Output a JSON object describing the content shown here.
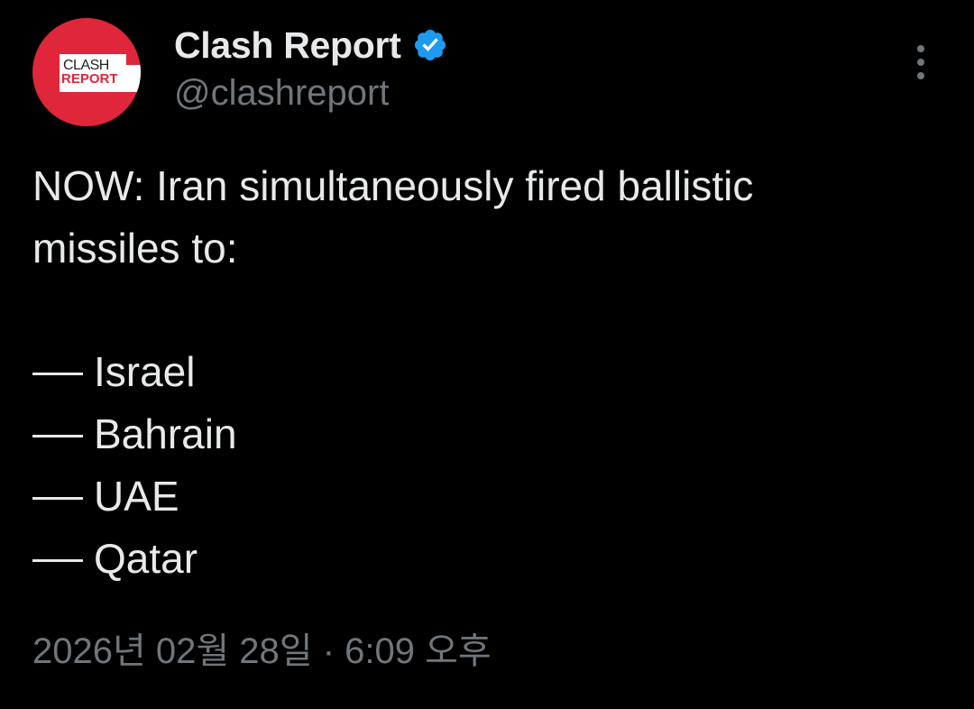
{
  "author": {
    "avatar_text_top": "CLASH",
    "avatar_text_bottom": "REPORT",
    "display_name": "Clash Report",
    "handle": "@clashreport",
    "verified": true
  },
  "tweet": {
    "text_lines": [
      "NOW: Iran simultaneously fired ballistic",
      "missiles to:"
    ],
    "list_items": [
      "Israel",
      "Bahrain",
      "UAE",
      "Qatar"
    ],
    "timestamp": "2026년 02월 28일 · 6:09 오후"
  },
  "icons": {
    "verified": "verified-badge-icon",
    "more": "more-options-icon"
  },
  "colors": {
    "background": "#000000",
    "text_primary": "#e7e9ea",
    "text_secondary": "#71767b",
    "verified_blue": "#1d9bf0",
    "avatar_red": "#e0263a"
  }
}
